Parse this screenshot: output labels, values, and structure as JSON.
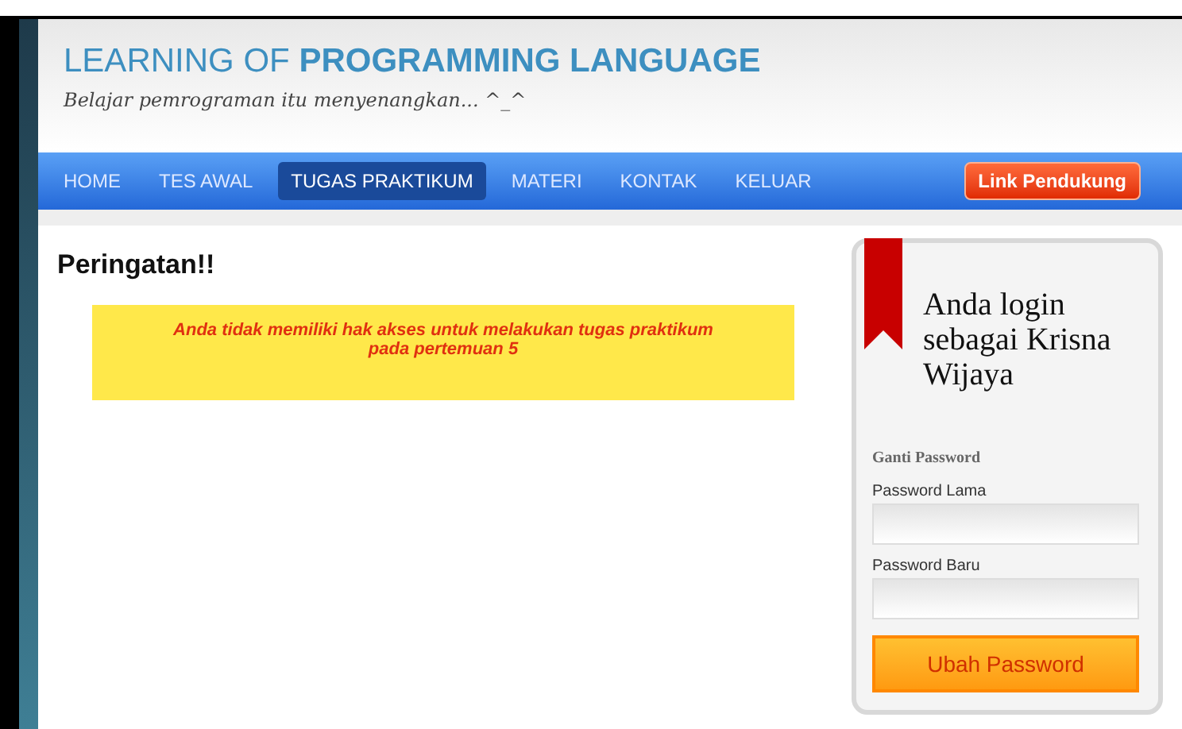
{
  "header": {
    "title_light": "LEARNING OF",
    "title_bold": "PROGRAMMING LANGUAGE",
    "tagline": "Belajar pemrograman itu menyenangkan... ^_^"
  },
  "nav": {
    "items": [
      {
        "label": "HOME",
        "selected": false
      },
      {
        "label": "TES AWAL",
        "selected": false
      },
      {
        "label": "TUGAS PRAKTIKUM",
        "selected": true
      },
      {
        "label": "MATERI",
        "selected": false
      },
      {
        "label": "KONTAK",
        "selected": false
      },
      {
        "label": "KELUAR",
        "selected": false
      }
    ],
    "link_button": "Link Pendukung"
  },
  "main": {
    "heading": "Peringatan!!",
    "alert": "Anda tidak memiliki hak akses untuk melakukan tugas praktikum pada pertemuan 5"
  },
  "sidebar": {
    "greeting": "Anda login sebagai Krisna Wijaya",
    "section_title": "Ganti Password",
    "fields": [
      {
        "label": "Password Lama"
      },
      {
        "label": "Password Baru"
      }
    ],
    "submit": "Ubah Password"
  }
}
